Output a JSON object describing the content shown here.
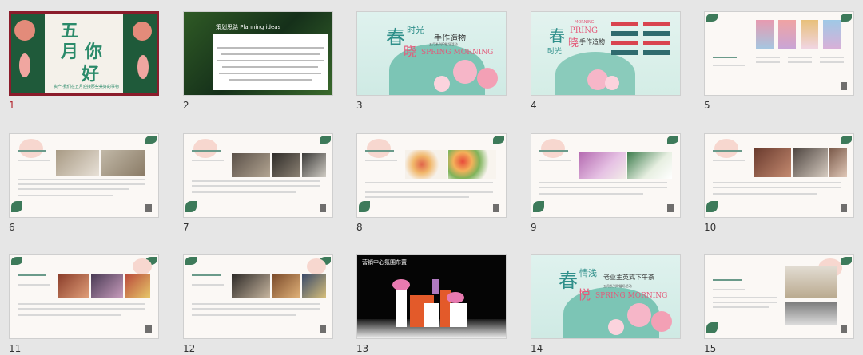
{
  "slides": [
    {
      "number": "1",
      "title_lines": [
        "五",
        "月",
        "你",
        "好"
      ],
      "subtitle": "资产-我们在五月迎接那些美好的事物"
    },
    {
      "number": "2",
      "heading": "策划思路 Planning ideas"
    },
    {
      "number": "3",
      "big": "春",
      "mid1": "时光",
      "mid2": "晓",
      "spring": "SPRING MORNING",
      "sub": "手作造物",
      "tag": "五月系列IP暖场活动"
    },
    {
      "number": "4",
      "big": "春",
      "mid1": "晓",
      "mid2": "时光",
      "word1": "MORNING",
      "word2": "PRING",
      "sub": "手作造物"
    },
    {
      "number": "5"
    },
    {
      "number": "6"
    },
    {
      "number": "7"
    },
    {
      "number": "8"
    },
    {
      "number": "9"
    },
    {
      "number": "10"
    },
    {
      "number": "11"
    },
    {
      "number": "12"
    },
    {
      "number": "13",
      "heading": "营销中心氛围布置"
    },
    {
      "number": "14",
      "big": "春",
      "mid1": "情浅",
      "mid2": "悦",
      "spring": "SPRING MORNING",
      "sub": "老业主英式下午茶",
      "tag": "五月系列IP暖场活动"
    },
    {
      "number": "15"
    }
  ]
}
